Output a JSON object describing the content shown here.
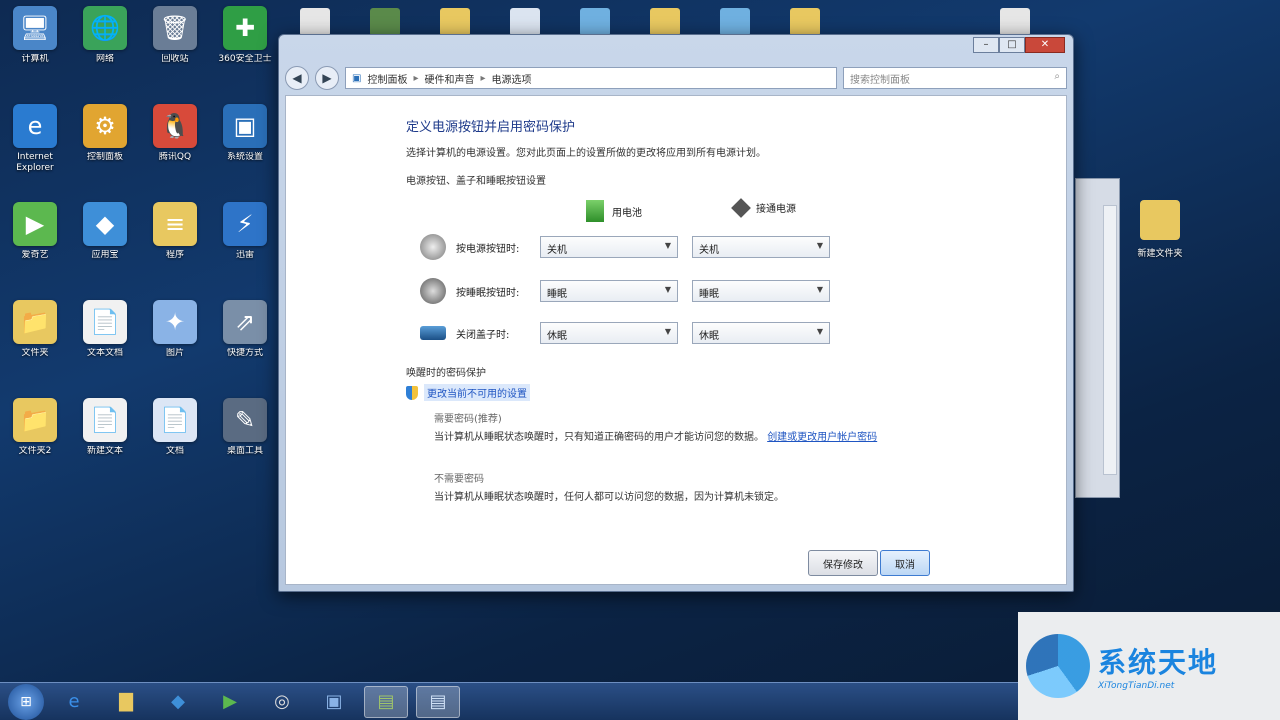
{
  "desktop": {
    "icons": [
      {
        "label": "计算机",
        "glyph": "🖥",
        "color": "#4a86c8"
      },
      {
        "label": "网络",
        "glyph": "🌐",
        "color": "#3aa35a"
      },
      {
        "label": "回收站",
        "glyph": "🗑",
        "color": "#6a7d96"
      },
      {
        "label": "360安全卫士",
        "glyph": "✚",
        "color": "#2f9e45"
      },
      {
        "label": "Internet Explorer",
        "glyph": "e",
        "color": "#2a7bd0"
      },
      {
        "label": "控制面板",
        "glyph": "⚙",
        "color": "#e1a531"
      },
      {
        "label": "腾讯QQ",
        "glyph": "🐧",
        "color": "#d84a3a"
      },
      {
        "label": "系统设置",
        "glyph": "▣",
        "color": "#2a6fb8"
      },
      {
        "label": "爱奇艺",
        "glyph": "▶",
        "color": "#5cb84f"
      },
      {
        "label": "应用宝",
        "glyph": "◆",
        "color": "#3e8fd8"
      },
      {
        "label": "程序",
        "glyph": "≡",
        "color": "#e8c860"
      },
      {
        "label": "迅雷",
        "glyph": "⚡",
        "color": "#2e74c8"
      },
      {
        "label": "文件夹",
        "glyph": "📁",
        "color": "#e8c860"
      },
      {
        "label": "文本文档",
        "glyph": "📄",
        "color": "#f1f1f1"
      },
      {
        "label": "图片",
        "glyph": "✦",
        "color": "#8ab3e6"
      },
      {
        "label": "快捷方式",
        "glyph": "⇗",
        "color": "#7a8fa8"
      },
      {
        "label": "文件夹2",
        "glyph": "📁",
        "color": "#e8c860"
      },
      {
        "label": "新建文本",
        "glyph": "📄",
        "color": "#f1f1f1"
      },
      {
        "label": "文档",
        "glyph": "📄",
        "color": "#dce6f5"
      },
      {
        "label": "桌面工具",
        "glyph": "✎",
        "color": "#5a6b82"
      }
    ],
    "right_icon_label": "新建文件夹"
  },
  "dialog": {
    "address_parts": [
      "控制面板",
      "硬件和声音",
      "电源选项"
    ],
    "search_placeholder": "搜索控制面板",
    "title": "定义电源按钮并启用密码保护",
    "description": "选择计算机的电源设置。您对此页面上的设置所做的更改将应用到所有电源计划。",
    "subheading": "电源按钮、盖子和睡眠按钮设置",
    "columns": [
      "用电池",
      "接通电源"
    ],
    "settings": [
      {
        "name": "按电源按钮时:",
        "battery": "关机",
        "plugged": "关机"
      },
      {
        "name": "按睡眠按钮时:",
        "battery": "睡眠",
        "plugged": "睡眠"
      },
      {
        "name": "关闭盖子时:",
        "battery": "休眠",
        "plugged": "休眠"
      }
    ],
    "password_heading": "唤醒时的密码保护",
    "password_link": "更改当前不可用的设置",
    "option1_heading": "需要密码(推荐)",
    "option1_text": "当计算机从睡眠状态唤醒时，只有知道正确密码的用户才能访问您的数据。",
    "option1_link": "创建或更改用户帐户密码",
    "option2_heading": "不需要密码",
    "option2_text": "当计算机从睡眠状态唤醒时，任何人都可以访问您的数据，因为计算机未锁定。",
    "buttons": {
      "save": "保存修改",
      "cancel": "取消"
    }
  },
  "watermark": {
    "title": "系统天地",
    "subtitle": "XiTongTianDi.net"
  },
  "taskbar": {
    "items": [
      "start",
      "ie",
      "explorer",
      "360",
      "media",
      "app",
      "panel",
      "window1",
      "window2"
    ]
  }
}
